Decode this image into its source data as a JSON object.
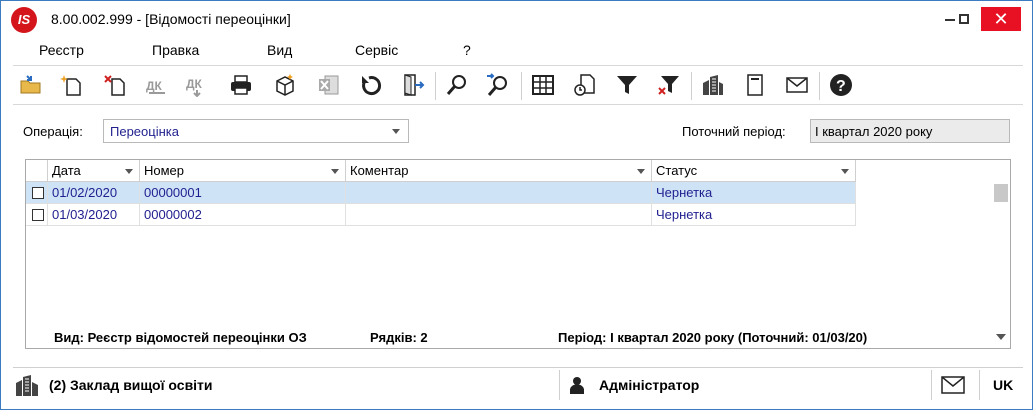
{
  "window": {
    "title": "8.00.002.999 - [Відомості переоцінки]",
    "logo_text": "IS"
  },
  "menu": [
    "Реєстр",
    "Правка",
    "Вид",
    "Сервіс",
    "?"
  ],
  "toolbar": {
    "icons": [
      "open-folder-icon",
      "new-document-icon",
      "delete-document-icon",
      "post-document-icon",
      "unpost-document-icon",
      "print-icon",
      "package-icon",
      "excel-export-icon",
      "refresh-icon",
      "exit-icon",
      "find-icon",
      "find-next-icon",
      "table-icon",
      "schedule-document-icon",
      "filter-icon",
      "clear-filter-icon",
      "organization-icon",
      "bookmark-document-icon",
      "mail-icon",
      "help-icon"
    ]
  },
  "operation": {
    "label": "Операція:",
    "value": "Переоцінка"
  },
  "current_period": {
    "label": "Поточний період:",
    "value": "І квартал 2020 року"
  },
  "grid": {
    "columns": [
      "Дата",
      "Номер",
      "Коментар",
      "Статус"
    ],
    "rows": [
      {
        "date": "01/02/2020",
        "number": "00000001",
        "comment": "",
        "status": "Чернетка"
      },
      {
        "date": "01/03/2020",
        "number": "00000002",
        "comment": "",
        "status": "Чернетка"
      }
    ]
  },
  "status": {
    "view": "Вид: Реєстр відомостей переоцінки ОЗ",
    "rows": "Рядків: 2",
    "period": "Період: І квартал 2020 року (Поточний: 01/03/20)"
  },
  "bottom": {
    "organization": "(2) Заклад вищої освіти",
    "user": "Адміністратор",
    "language": "UK"
  },
  "colors": {
    "accent_text": "#1f1f8f",
    "selection": "#cfe3f7",
    "close_button": "#e81123",
    "logo": "#d4151b"
  }
}
